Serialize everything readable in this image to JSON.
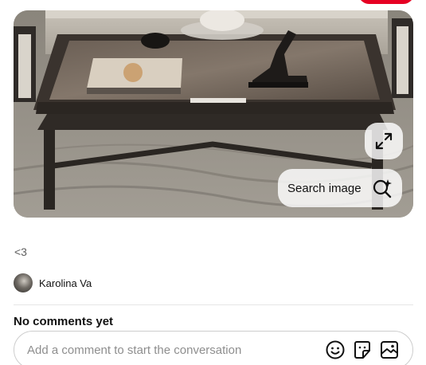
{
  "pin": {
    "image_alt": "Dark wood square coffee table with tray, books and sculpture",
    "expand_icon": "expand-arrows-icon",
    "search_image_label": "Search image",
    "search_icon": "sparkle-search-icon"
  },
  "description": "<3",
  "author": {
    "name": "Karolina Va"
  },
  "comments": {
    "heading": "No comments yet",
    "placeholder": "Add a comment to start the conversation",
    "icons": [
      "emoji-icon",
      "sticker-icon",
      "image-icon"
    ]
  },
  "colors": {
    "brand_red": "#e60023",
    "text_muted": "#5f5f5f",
    "border": "#cdcdcd"
  }
}
